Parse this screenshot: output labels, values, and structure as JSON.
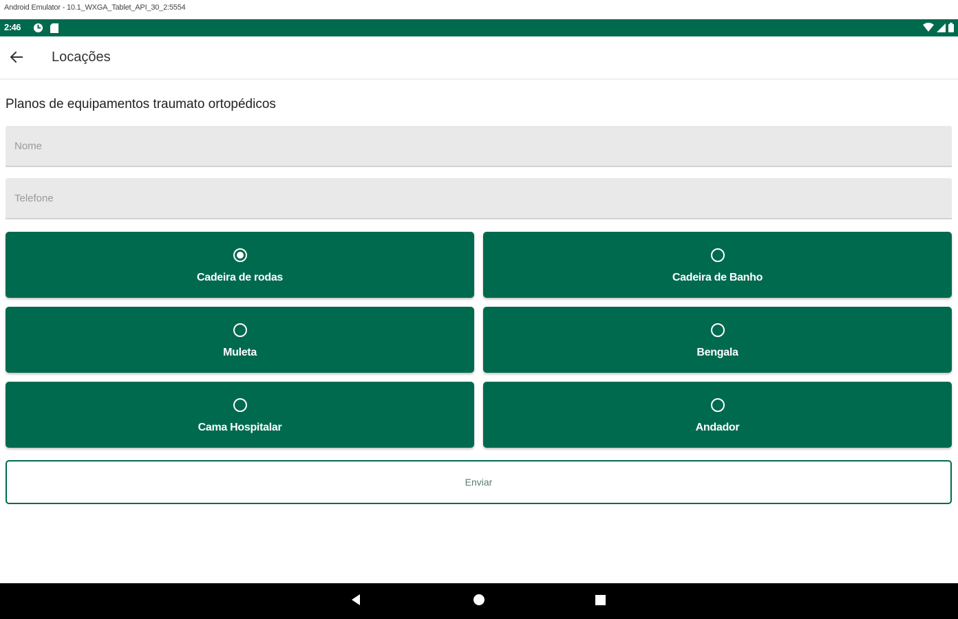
{
  "window": {
    "title": "Android Emulator - 10.1_WXGA_Tablet_API_30_2:5554"
  },
  "status_bar": {
    "time": "2:46",
    "background": "#006a4e",
    "left_icons": [
      "settings-status-icon",
      "sd-card-icon"
    ],
    "right_icons": [
      "wifi-icon",
      "cell-signal-icon",
      "battery-icon"
    ]
  },
  "app_bar": {
    "title": "Locações",
    "back_icon": "arrow-back-icon"
  },
  "form": {
    "section_title": "Planos de equipamentos traumato ortopédicos",
    "fields": [
      {
        "name": "nome",
        "placeholder": "Nome",
        "value": ""
      },
      {
        "name": "telefone",
        "placeholder": "Telefone",
        "value": ""
      }
    ],
    "options": [
      {
        "label": "Cadeira de rodas",
        "selected": true
      },
      {
        "label": "Cadeira de Banho",
        "selected": false
      },
      {
        "label": "Muleta",
        "selected": false
      },
      {
        "label": "Bengala",
        "selected": false
      },
      {
        "label": "Cama Hospitalar",
        "selected": false
      },
      {
        "label": "Andador",
        "selected": false
      }
    ],
    "submit_label": "Enviar",
    "accent_color": "#006a4e"
  },
  "nav_bar": {
    "icons": [
      "nav-back-icon",
      "nav-home-icon",
      "nav-recents-icon"
    ]
  }
}
